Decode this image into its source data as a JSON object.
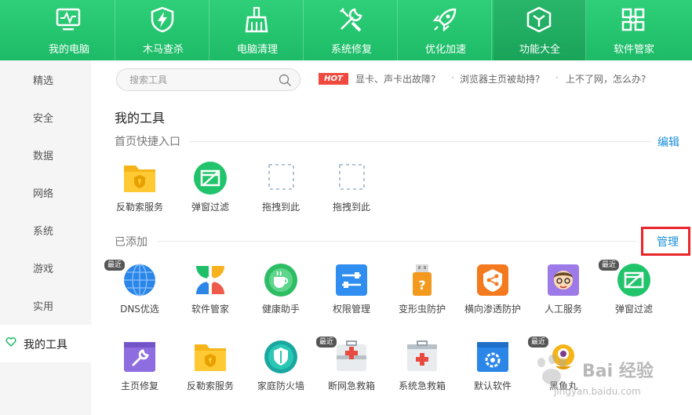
{
  "top_tabs": [
    {
      "label": "我的电脑",
      "icon": "monitor-pulse-icon"
    },
    {
      "label": "木马查杀",
      "icon": "shield-bolt-icon"
    },
    {
      "label": "电脑清理",
      "icon": "broom-icon"
    },
    {
      "label": "系统修复",
      "icon": "wrench-screwdriver-icon"
    },
    {
      "label": "优化加速",
      "icon": "rocket-icon"
    },
    {
      "label": "功能大全",
      "icon": "cube-icon",
      "active": true
    },
    {
      "label": "软件管家",
      "icon": "apps-grid-icon"
    }
  ],
  "sidebar": {
    "items": [
      {
        "label": "精选"
      },
      {
        "label": "安全"
      },
      {
        "label": "数据"
      },
      {
        "label": "网络"
      },
      {
        "label": "系统"
      },
      {
        "label": "游戏"
      },
      {
        "label": "实用"
      },
      {
        "label": "我的工具",
        "active": true
      }
    ]
  },
  "search": {
    "placeholder": "搜索工具"
  },
  "hot": {
    "badge": "HOT",
    "links": [
      "显卡、声卡出故障?",
      "浏览器主页被劫持?",
      "上不了网，怎么办?"
    ],
    "separator": "·"
  },
  "main": {
    "title": "我的工具",
    "shortcuts_label": "首页快捷入口",
    "edit_label": "编辑",
    "added_label": "已添加",
    "manage_label": "管理",
    "recent_badge": "最近"
  },
  "shortcuts": [
    {
      "label": "反勒索服务",
      "icon": "ransom-folder-icon"
    },
    {
      "label": "弹窗过滤",
      "icon": "popup-filter-icon"
    },
    {
      "label": "拖拽到此",
      "icon": "drop-slot-icon"
    },
    {
      "label": "拖拽到此",
      "icon": "drop-slot-icon"
    }
  ],
  "added_row1": [
    {
      "label": "DNS优选",
      "icon": "dns-globe-icon",
      "recent": true
    },
    {
      "label": "软件管家",
      "icon": "software-flower-icon"
    },
    {
      "label": "健康助手",
      "icon": "health-cup-icon"
    },
    {
      "label": "权限管理",
      "icon": "permission-sliders-icon"
    },
    {
      "label": "变形虫防护",
      "icon": "usb-shield-icon"
    },
    {
      "label": "横向渗透防护",
      "icon": "lateral-network-icon"
    },
    {
      "label": "人工服务",
      "icon": "support-person-icon"
    },
    {
      "label": "弹窗过滤",
      "icon": "popup-filter-icon",
      "recent": true
    }
  ],
  "added_row2": [
    {
      "label": "主页修复",
      "icon": "homepage-wrench-icon"
    },
    {
      "label": "反勒索服务",
      "icon": "ransom-folder-icon"
    },
    {
      "label": "家庭防火墙",
      "icon": "family-firewall-icon"
    },
    {
      "label": "断网急救箱",
      "icon": "network-firstaid-icon",
      "recent": true
    },
    {
      "label": "系统急救箱",
      "icon": "system-firstaid-icon"
    },
    {
      "label": "默认软件",
      "icon": "default-software-icon"
    },
    {
      "label": "黑鱼丸",
      "icon": "blackfish-icon",
      "recent": true
    }
  ],
  "watermark": {
    "text": "Bai 经验",
    "url": "jingyan.baidu.com"
  },
  "colors": {
    "brand_green": "#1dbb67",
    "hot_red": "#f04a3f",
    "link_blue": "#1a8fd8",
    "highlight_red": "#e8262b"
  }
}
